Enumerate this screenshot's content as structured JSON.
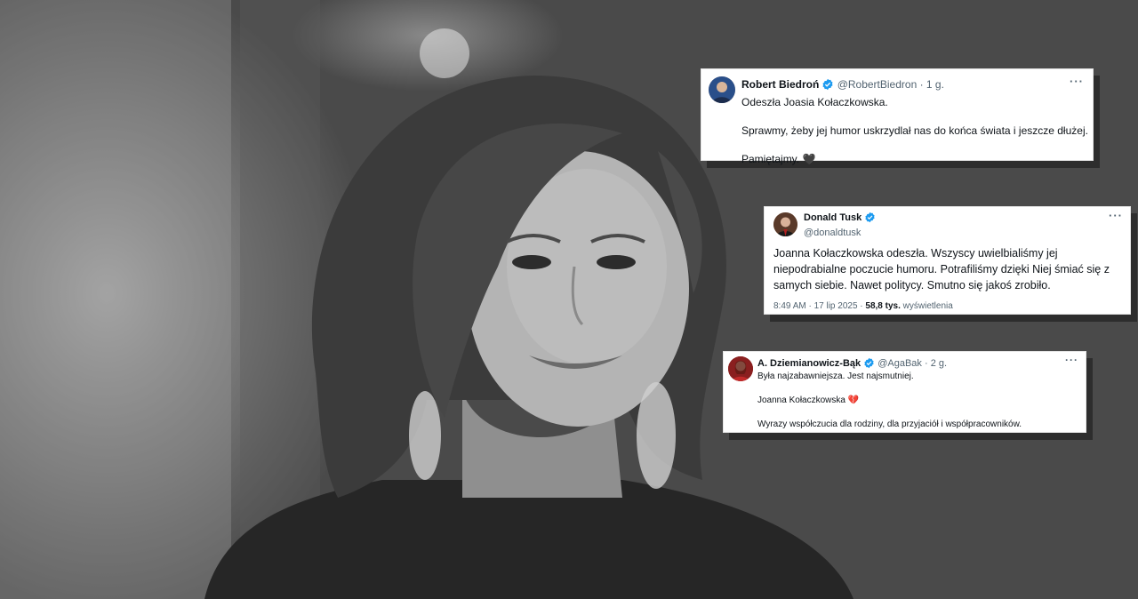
{
  "tweets": [
    {
      "name": "Robert Biedroń",
      "handle": "@RobertBiedron",
      "time": "· 1 g.",
      "more": "···",
      "paragraphs": [
        "Odeszła Joasia Kołaczkowska.",
        "Sprawmy, żeby jej humor uskrzydlał nas do końca świata i jeszcze dłużej.",
        "Pamiętajmy. 🖤"
      ]
    },
    {
      "name": "Donald Tusk",
      "handle": "@donaldtusk",
      "more": "···",
      "text": "Joanna Kołaczkowska odeszła. Wszyscy uwielbialiśmy jej niepodrabialne poczucie humoru. Potrafiliśmy dzięki Niej śmiać się z samych siebie. Nawet politycy. Smutno się jakoś zrobiło.",
      "timestamp": "8:49 AM · 17 lip 2025 · ",
      "views_count": "58,8 tys.",
      "views_label": "wyświetlenia"
    },
    {
      "name": "A. Dziemianowicz-Bąk",
      "handle": "@AgaBak",
      "time": "· 2 g.",
      "more": "···",
      "paragraphs": [
        "Była najzabawniejsza. Jest najsmutniej.",
        "Joanna Kołaczkowska 💔",
        "Wyrazy współczucia dla rodziny, dla przyjaciół i współpracowników."
      ]
    }
  ],
  "colors": {
    "verified": "#1d9bf0",
    "secondary_text": "#536471",
    "primary_text": "#0f1419"
  }
}
